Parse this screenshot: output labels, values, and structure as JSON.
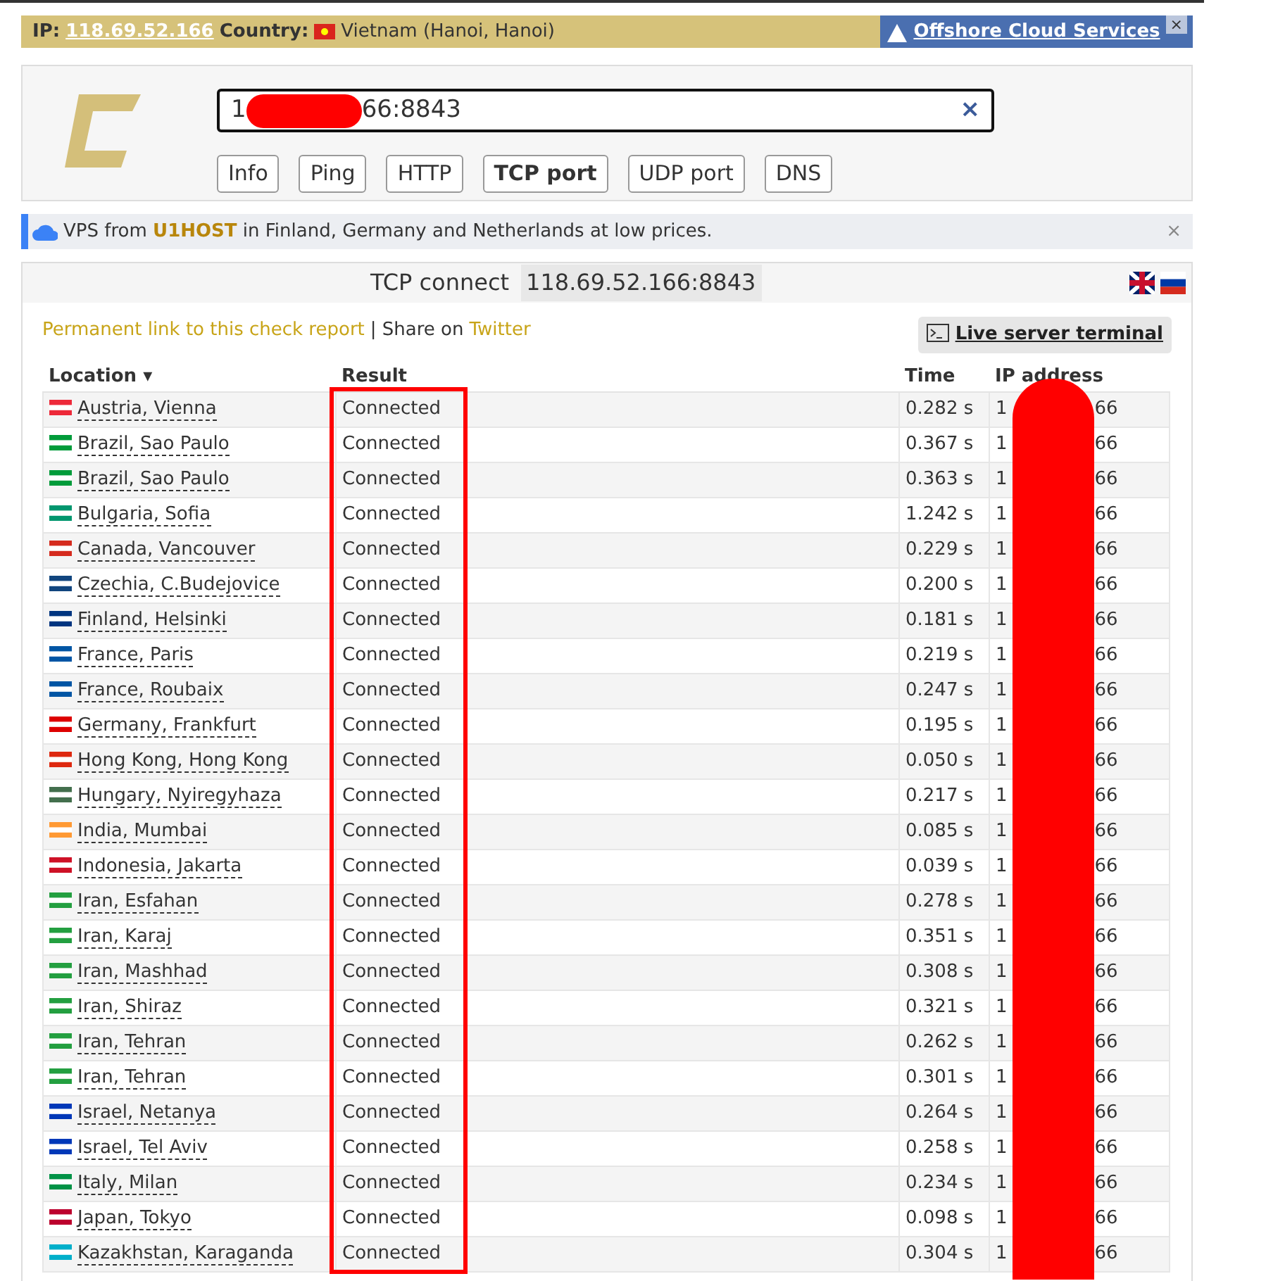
{
  "top_bar": {
    "ip_label": "IP:",
    "ip": "118.69.52.166",
    "country_label": "Country:",
    "country": "Vietnam (Hanoi, Hanoi)",
    "ad_link": "Offshore Cloud Services",
    "close": "×"
  },
  "search": {
    "value_start": "1",
    "value_end": "66:8843",
    "clear": "×"
  },
  "tabs": [
    {
      "label": "Info",
      "selected": false
    },
    {
      "label": "Ping",
      "selected": false
    },
    {
      "label": "HTTP",
      "selected": false
    },
    {
      "label": "TCP port",
      "selected": true
    },
    {
      "label": "UDP port",
      "selected": false
    },
    {
      "label": "DNS",
      "selected": false
    }
  ],
  "ad_bar": {
    "text": "VPS from **U1HOST** in Finland, Germany and Netherlands at low prices.",
    "close": "×"
  },
  "report": {
    "title": "TCP connect",
    "target": "118.69.52.166:8843",
    "permalink": "Permanent link to this check report",
    "share_text": "| Share on",
    "share_link": "Twitter",
    "terminal_button": "Live server terminal"
  },
  "table": {
    "columns": [
      "Location ▾",
      "Result",
      "Time",
      "IP address"
    ],
    "rows": [
      {
        "location": "Austria, Vienna",
        "color": "#ed2939",
        "result": "Connected",
        "time": "0.282 s",
        "ip_start": "1",
        "ip_end": "66"
      },
      {
        "location": "Brazil, Sao Paulo",
        "color": "#009b3a",
        "result": "Connected",
        "time": "0.367 s",
        "ip_start": "1",
        "ip_end": "66"
      },
      {
        "location": "Brazil, Sao Paulo",
        "color": "#009b3a",
        "result": "Connected",
        "time": "0.363 s",
        "ip_start": "1",
        "ip_end": "66"
      },
      {
        "location": "Bulgaria, Sofia",
        "color": "#00966e",
        "result": "Connected",
        "time": "1.242 s",
        "ip_start": "1",
        "ip_end": "66"
      },
      {
        "location": "Canada, Vancouver",
        "color": "#d52b1e",
        "result": "Connected",
        "time": "0.229 s",
        "ip_start": "1",
        "ip_end": "66"
      },
      {
        "location": "Czechia, C.Budejovice",
        "color": "#11457e",
        "result": "Connected",
        "time": "0.200 s",
        "ip_start": "1",
        "ip_end": "66"
      },
      {
        "location": "Finland, Helsinki",
        "color": "#003580",
        "result": "Connected",
        "time": "0.181 s",
        "ip_start": "1",
        "ip_end": "66"
      },
      {
        "location": "France, Paris",
        "color": "#0055a4",
        "result": "Connected",
        "time": "0.219 s",
        "ip_start": "1",
        "ip_end": "66"
      },
      {
        "location": "France, Roubaix",
        "color": "#0055a4",
        "result": "Connected",
        "time": "0.247 s",
        "ip_start": "1",
        "ip_end": "66"
      },
      {
        "location": "Germany, Frankfurt",
        "color": "#dd0000",
        "result": "Connected",
        "time": "0.195 s",
        "ip_start": "1",
        "ip_end": "66"
      },
      {
        "location": "Hong Kong, Hong Kong",
        "color": "#de2910",
        "result": "Connected",
        "time": "0.050 s",
        "ip_start": "1",
        "ip_end": "66"
      },
      {
        "location": "Hungary, Nyiregyhaza",
        "color": "#436f4d",
        "result": "Connected",
        "time": "0.217 s",
        "ip_start": "1",
        "ip_end": "66"
      },
      {
        "location": "India, Mumbai",
        "color": "#ff9933",
        "result": "Connected",
        "time": "0.085 s",
        "ip_start": "1",
        "ip_end": "66"
      },
      {
        "location": "Indonesia, Jakarta",
        "color": "#ce1126",
        "result": "Connected",
        "time": "0.039 s",
        "ip_start": "1",
        "ip_end": "66"
      },
      {
        "location": "Iran, Esfahan",
        "color": "#239f40",
        "result": "Connected",
        "time": "0.278 s",
        "ip_start": "1",
        "ip_end": "66"
      },
      {
        "location": "Iran, Karaj",
        "color": "#239f40",
        "result": "Connected",
        "time": "0.351 s",
        "ip_start": "1",
        "ip_end": "66"
      },
      {
        "location": "Iran, Mashhad",
        "color": "#239f40",
        "result": "Connected",
        "time": "0.308 s",
        "ip_start": "1",
        "ip_end": "66"
      },
      {
        "location": "Iran, Shiraz",
        "color": "#239f40",
        "result": "Connected",
        "time": "0.321 s",
        "ip_start": "1",
        "ip_end": "66"
      },
      {
        "location": "Iran, Tehran",
        "color": "#239f40",
        "result": "Connected",
        "time": "0.262 s",
        "ip_start": "1",
        "ip_end": "66"
      },
      {
        "location": "Iran, Tehran",
        "color": "#239f40",
        "result": "Connected",
        "time": "0.301 s",
        "ip_start": "1",
        "ip_end": "66"
      },
      {
        "location": "Israel, Netanya",
        "color": "#0038b8",
        "result": "Connected",
        "time": "0.264 s",
        "ip_start": "1",
        "ip_end": "66"
      },
      {
        "location": "Israel, Tel Aviv",
        "color": "#0038b8",
        "result": "Connected",
        "time": "0.258 s",
        "ip_start": "1",
        "ip_end": "66"
      },
      {
        "location": "Italy, Milan",
        "color": "#009246",
        "result": "Connected",
        "time": "0.234 s",
        "ip_start": "1",
        "ip_end": "66"
      },
      {
        "location": "Japan, Tokyo",
        "color": "#bc002d",
        "result": "Connected",
        "time": "0.098 s",
        "ip_start": "1",
        "ip_end": "66"
      },
      {
        "location": "Kazakhstan, Karaganda",
        "color": "#00afca",
        "result": "Connected",
        "time": "0.304 s",
        "ip_start": "1",
        "ip_end": "66"
      }
    ]
  }
}
